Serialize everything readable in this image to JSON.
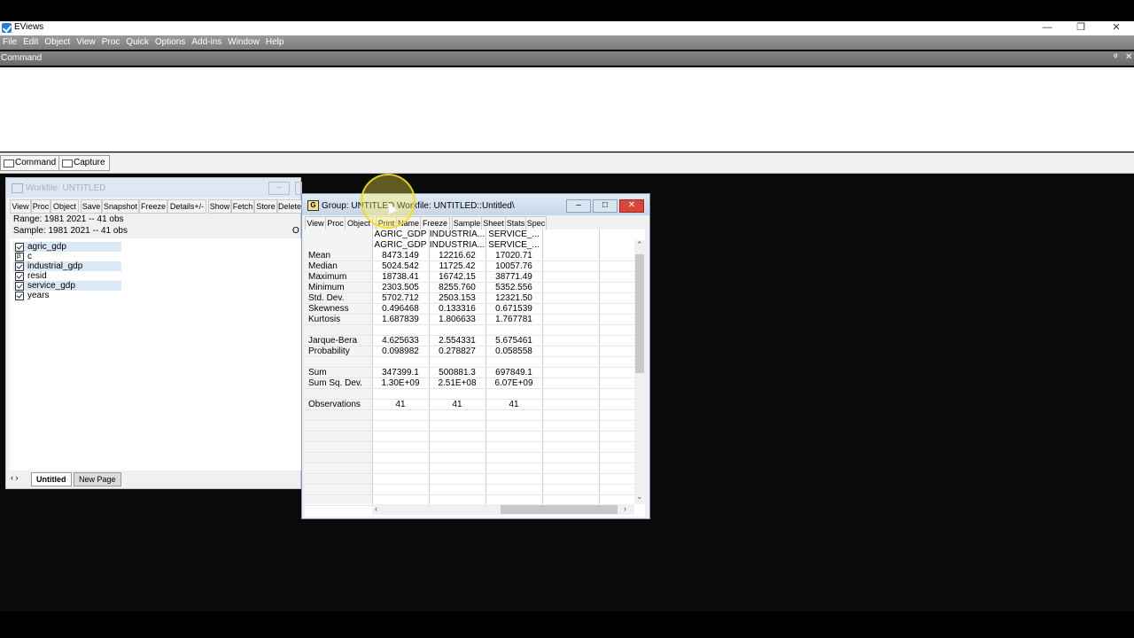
{
  "app": {
    "title": "EViews",
    "minimize": "—",
    "restore": "❐",
    "close": "✕"
  },
  "menu": [
    "File",
    "Edit",
    "Object",
    "View",
    "Proc",
    "Quick",
    "Options",
    "Add-ins",
    "Window",
    "Help"
  ],
  "command": {
    "label": "Command",
    "pin": "ᵠ",
    "close": "✕"
  },
  "tabs": {
    "command": "Command",
    "capture": "Capture"
  },
  "workfile": {
    "title": "Workfile: UNTITLED",
    "toolbar": [
      "View",
      "Proc",
      "Object",
      "Save",
      "Snapshot",
      "Freeze",
      "Details+/-",
      "Show",
      "Fetch",
      "Store",
      "Delete"
    ],
    "range": "Range:  1981 2021   --   41 obs",
    "sample": "Sample: 1981 2021   --   41 obs",
    "right_cut": "O",
    "items": [
      {
        "name": "agric_gdp",
        "icon": "series-icon",
        "selected": true
      },
      {
        "name": "c",
        "icon": "coef-icon",
        "selected": false
      },
      {
        "name": "industrial_gdp",
        "icon": "series-icon",
        "selected": true
      },
      {
        "name": "resid",
        "icon": "series-icon",
        "selected": false
      },
      {
        "name": "service_gdp",
        "icon": "series-icon",
        "selected": true
      },
      {
        "name": "years",
        "icon": "series-icon",
        "selected": false
      }
    ],
    "pages": {
      "nav": "‹ ›",
      "active": "Untitled",
      "new": "New Page"
    }
  },
  "group": {
    "title": "Group: UNTITLED   Workfile: UNTITLED::Untitled\\",
    "icon_letter": "G",
    "toolbar": [
      "View",
      "Proc",
      "Object",
      "Print",
      "Name",
      "Freeze",
      "Sample",
      "Sheet",
      "Stats",
      "Spec"
    ],
    "columns": [
      "AGRIC_GDP",
      "INDUSTRIA...",
      "SERVICE_..."
    ],
    "subheaders": [
      "AGRIC_GDP",
      "INDUSTRIA...",
      "SERVICE_..."
    ],
    "rows": [
      {
        "label": "Mean",
        "values": [
          "8473.149",
          "12216.62",
          "17020.71"
        ]
      },
      {
        "label": "Median",
        "values": [
          "5024.542",
          "11725.42",
          "10057.76"
        ]
      },
      {
        "label": "Maximum",
        "values": [
          "18738.41",
          "16742.15",
          "38771.49"
        ]
      },
      {
        "label": "Minimum",
        "values": [
          "2303.505",
          "8255.760",
          "5352.556"
        ]
      },
      {
        "label": "Std. Dev.",
        "values": [
          "5702.712",
          "2503.153",
          "12321.50"
        ]
      },
      {
        "label": "Skewness",
        "values": [
          "0.496468",
          "0.133316",
          "0.671539"
        ]
      },
      {
        "label": "Kurtosis",
        "values": [
          "1.687839",
          "1.806633",
          "1.767781"
        ]
      },
      {
        "label": "",
        "values": [
          "",
          "",
          ""
        ]
      },
      {
        "label": "Jarque-Bera",
        "values": [
          "4.625633",
          "2.554331",
          "5.675461"
        ]
      },
      {
        "label": "Probability",
        "values": [
          "0.098982",
          "0.278827",
          "0.058558"
        ]
      },
      {
        "label": "",
        "values": [
          "",
          "",
          ""
        ]
      },
      {
        "label": "Sum",
        "values": [
          "347399.1",
          "500881.3",
          "697849.1"
        ]
      },
      {
        "label": "Sum Sq. Dev.",
        "values": [
          "1.30E+09",
          "2.51E+08",
          "6.07E+09"
        ]
      },
      {
        "label": "",
        "values": [
          "",
          "",
          ""
        ]
      },
      {
        "label": "Observations",
        "values": [
          "41",
          "41",
          "41"
        ]
      }
    ]
  }
}
